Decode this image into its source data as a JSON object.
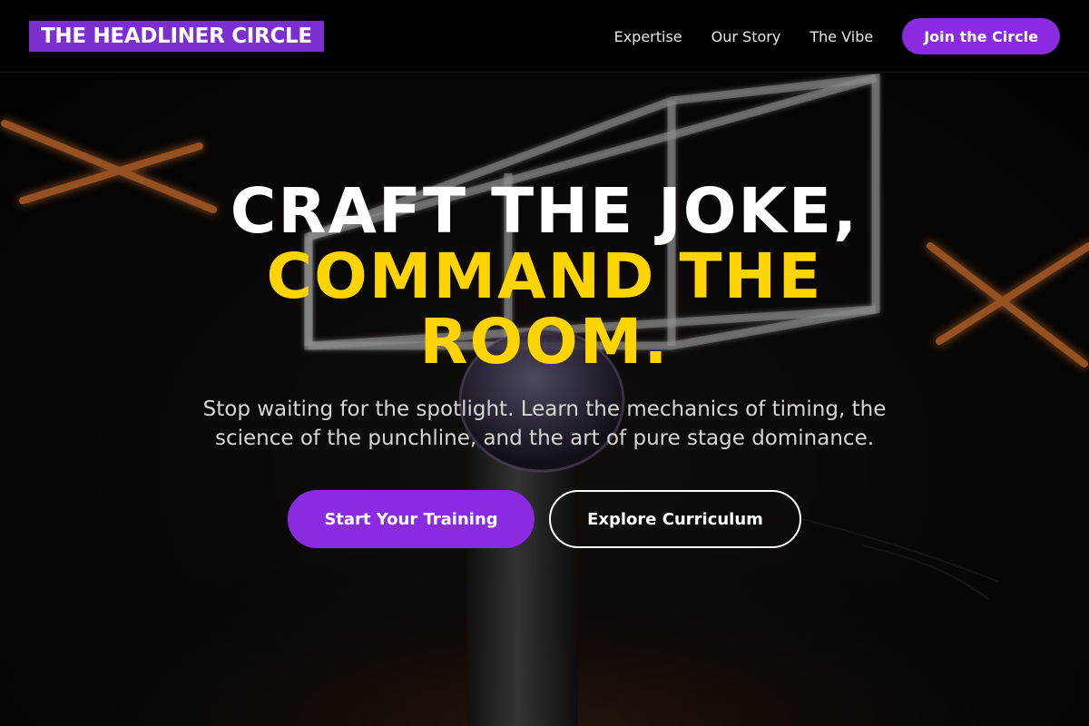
{
  "header": {
    "logo": "THE HEADLINER CIRCLE",
    "nav": [
      {
        "label": "Expertise"
      },
      {
        "label": "Our Story"
      },
      {
        "label": "The Vibe"
      }
    ],
    "cta_label": "Join the Circle"
  },
  "hero": {
    "headline_line1": "CRAFT THE JOKE,",
    "headline_line2": "COMMAND THE ROOM.",
    "subtitle": "Stop waiting for the spotlight. Learn the mechanics of timing, the science of the punchline, and the art of pure stage dominance.",
    "primary_button": "Start Your Training",
    "secondary_button": "Explore Curriculum"
  },
  "colors": {
    "accent_purple": "#8a2be2",
    "headline_yellow": "#ffd400",
    "neon_orange": "#ff7a2a"
  }
}
